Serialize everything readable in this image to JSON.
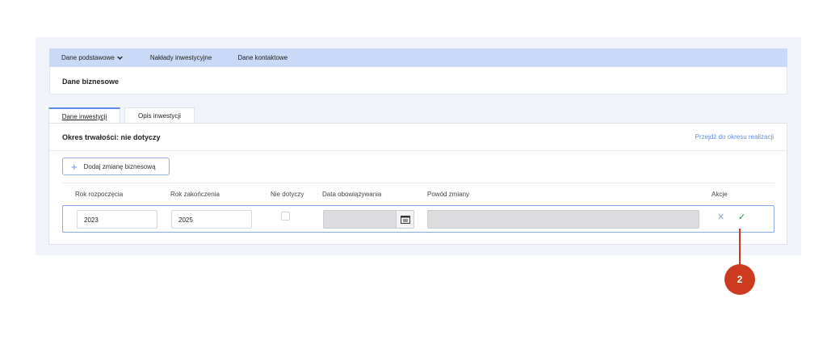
{
  "nav": {
    "items": [
      {
        "label": "Dane podstawowe"
      },
      {
        "label": "Nakłady inwestycyjne"
      },
      {
        "label": "Dane kontaktowe"
      }
    ]
  },
  "section": {
    "title": "Dane biznesowe"
  },
  "tabs": [
    {
      "label": "Dane inwestycji",
      "active": true
    },
    {
      "label": "Opis inwestycji",
      "active": false
    }
  ],
  "card": {
    "title": "Okres trwałości: nie dotyczy",
    "link": "Przejdź do okresu realizacji",
    "add_button": "Dodaj zmianę biznesową"
  },
  "table": {
    "headers": [
      "Rok rozpoczęcia",
      "Rok zakończenia",
      "Nie dotyczy",
      "Data obowiązywania",
      "Powód zmiany",
      "Akcje"
    ],
    "row": {
      "start_year": "2023",
      "end_year": "2025",
      "not_applicable": false,
      "valid_date": "",
      "reason": ""
    }
  },
  "icons": {
    "chevron": "chevron-down-icon",
    "plus": "plus-icon",
    "calendar": "calendar-icon",
    "cancel": "close-icon",
    "confirm": "check-icon"
  },
  "callout": {
    "number": "2"
  },
  "colors": {
    "nav_bg": "#c9daf8",
    "accent": "#5b8def",
    "callout": "#cc3b1f",
    "confirm": "#2f8f4e"
  }
}
